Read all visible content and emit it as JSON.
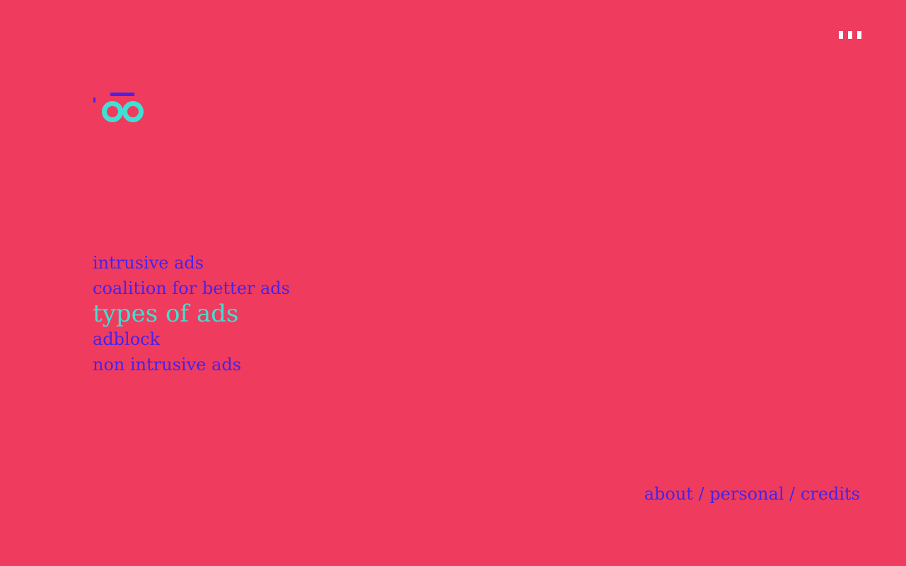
{
  "brand": {
    "logo_text": "oo",
    "logo_colors": {
      "letters": "#3FE0D3",
      "accent": "#4A22E6"
    }
  },
  "menu": {
    "icon": "menu-dots-icon",
    "color": "#FFFFFF"
  },
  "nav": {
    "items": [
      {
        "label": "intrusive ads",
        "active": false
      },
      {
        "label": "coalition for better ads",
        "active": false
      },
      {
        "label": "types of ads",
        "active": true
      },
      {
        "label": "adblock",
        "active": false
      },
      {
        "label": "non intrusive ads",
        "active": false
      }
    ]
  },
  "footer": {
    "links": [
      "about",
      "personal",
      "credits"
    ],
    "separator": " / "
  },
  "colors": {
    "background": "#EF3B5E",
    "nav_text": "#4A22E6",
    "nav_active": "#3FE0D3"
  }
}
